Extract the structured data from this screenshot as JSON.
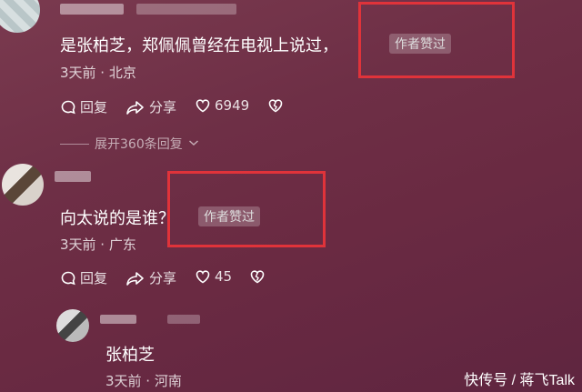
{
  "comment1": {
    "text": "是张柏芝，郑佩佩曾经在电视上说过，",
    "badge": "作者赞过",
    "meta": "3天前 · 北京",
    "reply_label": "回复",
    "share_label": "分享",
    "likes": "6949",
    "expand_label": "展开360条回复"
  },
  "comment2": {
    "text": "向太说的是谁？",
    "badge": "作者赞过",
    "meta": "3天前 · 广东",
    "reply_label": "回复",
    "share_label": "分享",
    "likes": "45"
  },
  "reply": {
    "text": "张柏芝",
    "meta": "3天前 · 河南"
  },
  "watermark": "快传号 / 蒋飞Talk",
  "colors": {
    "highlight_box": "#e0333a",
    "background": "#6e2f46"
  }
}
